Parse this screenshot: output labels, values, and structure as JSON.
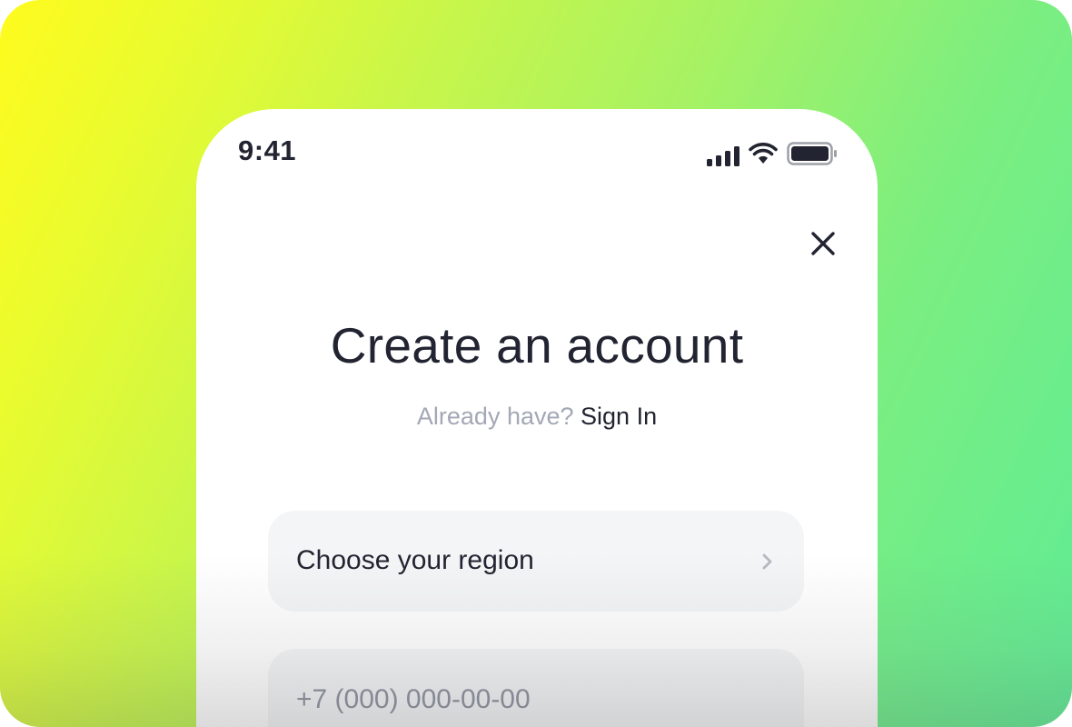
{
  "status_bar": {
    "time": "9:41",
    "icons": [
      "cellular-signal-icon",
      "wifi-icon",
      "battery-icon"
    ]
  },
  "close_button": {
    "icon": "close-icon"
  },
  "header": {
    "title": "Create an account",
    "prompt": "Already have?",
    "sign_in_label": "Sign In"
  },
  "form": {
    "region": {
      "label": "Choose your region",
      "icon": "chevron-right-icon"
    },
    "phone": {
      "value": "",
      "placeholder": "+7 (000) 000-00-00"
    }
  },
  "colors": {
    "background_gradient_start": "#fffb1e",
    "background_gradient_end": "#5fec95",
    "text_primary": "#222431",
    "text_secondary": "#a3a8b6",
    "field_background": "#f4f5f7"
  }
}
